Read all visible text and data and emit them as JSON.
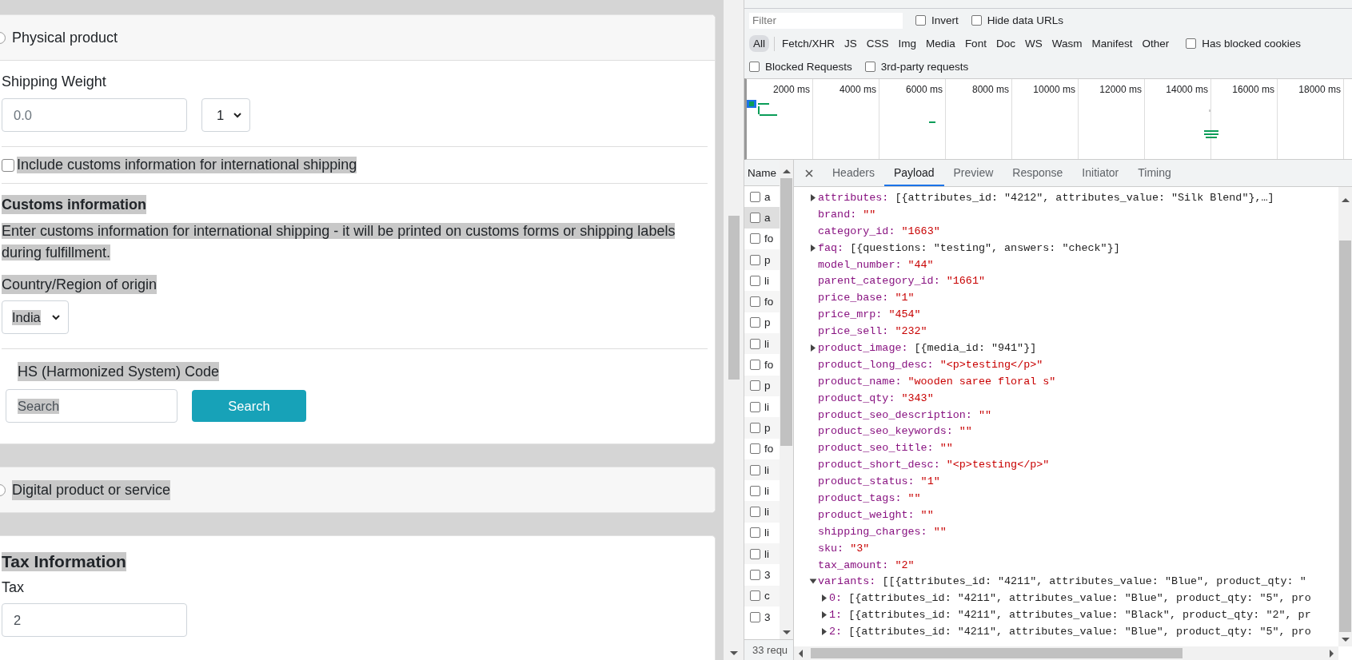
{
  "physical_card": {
    "option": {
      "label": "Physical product",
      "selected": false
    },
    "shipping_weight": {
      "label": "Shipping Weight",
      "placeholder": "0.0",
      "unit": "1"
    },
    "customs_checkbox": {
      "label": "Include customs information for international shipping",
      "checked": false,
      "highlighted": true
    },
    "customs_heading": {
      "text": "Customs information",
      "highlighted": true
    },
    "customs_description": {
      "text": "Enter customs information for international shipping - it will be printed on customs forms or shipping labels during fulfillment.",
      "highlighted": true
    },
    "country_label": {
      "text": "Country/Region of origin",
      "highlighted": true
    },
    "country": {
      "value": "India",
      "highlighted": true
    },
    "hs_label": {
      "text": "HS (Harmonized System) Code",
      "highlighted": true
    },
    "hs_search": {
      "value": "Search",
      "highlighted": true
    },
    "search_button": "Search"
  },
  "digital_card": {
    "option": {
      "label": "Digital product or service",
      "selected": false,
      "highlighted": true
    }
  },
  "tax_card": {
    "heading": {
      "text": "Tax Information",
      "highlighted": true
    },
    "tax_label": "Tax",
    "tax_value": "2"
  },
  "devtools": {
    "filter": {
      "placeholder": "Filter"
    },
    "filter_options": [
      {
        "label": "Invert",
        "checked": false
      },
      {
        "label": "Hide data URLs",
        "checked": false
      }
    ],
    "type_filters": [
      {
        "label": "All",
        "selected": true
      },
      {
        "label": "Fetch/XHR",
        "selected": false
      },
      {
        "label": "JS",
        "selected": false
      },
      {
        "label": "CSS",
        "selected": false
      },
      {
        "label": "Img",
        "selected": false
      },
      {
        "label": "Media",
        "selected": false
      },
      {
        "label": "Font",
        "selected": false
      },
      {
        "label": "Doc",
        "selected": false
      },
      {
        "label": "WS",
        "selected": false
      },
      {
        "label": "Wasm",
        "selected": false
      },
      {
        "label": "Manifest",
        "selected": false
      },
      {
        "label": "Other",
        "selected": false
      }
    ],
    "has_blocked_cookies": {
      "label": "Has blocked cookies",
      "checked": false
    },
    "request_options": [
      {
        "label": "Blocked Requests",
        "checked": false
      },
      {
        "label": "3rd-party requests",
        "checked": false
      }
    ],
    "timeline": {
      "ticks": [
        "2000 ms",
        "4000 ms",
        "6000 ms",
        "8000 ms",
        "10000 ms",
        "12000 ms",
        "14000 ms",
        "16000 ms",
        "18000 ms"
      ]
    },
    "requests": {
      "column": "Name",
      "rows": [
        {
          "name": "a",
          "selected": false
        },
        {
          "name": "a",
          "selected": true
        },
        {
          "name": "fo",
          "selected": false
        },
        {
          "name": "p",
          "selected": false
        },
        {
          "name": "li",
          "selected": false
        },
        {
          "name": "fo",
          "selected": false
        },
        {
          "name": "p",
          "selected": false
        },
        {
          "name": "li",
          "selected": false
        },
        {
          "name": "fo",
          "selected": false
        },
        {
          "name": "p",
          "selected": false
        },
        {
          "name": "li",
          "selected": false
        },
        {
          "name": "p",
          "selected": false
        },
        {
          "name": "fo",
          "selected": false
        },
        {
          "name": "li",
          "selected": false
        },
        {
          "name": "li",
          "selected": false
        },
        {
          "name": "li",
          "selected": false
        },
        {
          "name": "li",
          "selected": false
        },
        {
          "name": "li",
          "selected": false
        },
        {
          "name": "3",
          "selected": false
        },
        {
          "name": "c",
          "selected": false
        },
        {
          "name": "3",
          "selected": false
        }
      ]
    },
    "status": "33 requ",
    "detail_tabs": [
      {
        "label": "Headers",
        "selected": false
      },
      {
        "label": "Payload",
        "selected": true
      },
      {
        "label": "Preview",
        "selected": false
      },
      {
        "label": "Response",
        "selected": false
      },
      {
        "label": "Initiator",
        "selected": false
      },
      {
        "label": "Timing",
        "selected": false
      }
    ],
    "payload": [
      {
        "key": "attributes:",
        "value": "[{attributes_id: \"4212\", attributes_value: \"Silk Blend\"},…]",
        "kind": "object",
        "expanded": false
      },
      {
        "key": "brand:",
        "value": "\"\"",
        "kind": "string"
      },
      {
        "key": "category_id:",
        "value": "\"1663\"",
        "kind": "string"
      },
      {
        "key": "faq:",
        "value": "[{questions: \"testing\", answers: \"check\"}]",
        "kind": "object",
        "expanded": false
      },
      {
        "key": "model_number:",
        "value": "\"44\"",
        "kind": "string"
      },
      {
        "key": "parent_category_id:",
        "value": "\"1661\"",
        "kind": "string"
      },
      {
        "key": "price_base:",
        "value": "\"1\"",
        "kind": "string"
      },
      {
        "key": "price_mrp:",
        "value": "\"454\"",
        "kind": "string"
      },
      {
        "key": "price_sell:",
        "value": "\"232\"",
        "kind": "string"
      },
      {
        "key": "product_image:",
        "value": "[{media_id: \"941\"}]",
        "kind": "object",
        "expanded": false
      },
      {
        "key": "product_long_desc:",
        "value": "\"<p>testing</p>\"",
        "kind": "string"
      },
      {
        "key": "product_name:",
        "value": "\"wooden saree floral s\"",
        "kind": "string"
      },
      {
        "key": "product_qty:",
        "value": "\"343\"",
        "kind": "string"
      },
      {
        "key": "product_seo_description:",
        "value": "\"\"",
        "kind": "string"
      },
      {
        "key": "product_seo_keywords:",
        "value": "\"\"",
        "kind": "string"
      },
      {
        "key": "product_seo_title:",
        "value": "\"\"",
        "kind": "string"
      },
      {
        "key": "product_short_desc:",
        "value": "\"<p>testing</p>\"",
        "kind": "string"
      },
      {
        "key": "product_status:",
        "value": "\"1\"",
        "kind": "string"
      },
      {
        "key": "product_tags:",
        "value": "\"\"",
        "kind": "string"
      },
      {
        "key": "product_weight:",
        "value": "\"\"",
        "kind": "string"
      },
      {
        "key": "shipping_charges:",
        "value": "\"\"",
        "kind": "string"
      },
      {
        "key": "sku:",
        "value": "\"3\"",
        "kind": "string"
      },
      {
        "key": "tax_amount:",
        "value": "\"2\"",
        "kind": "string"
      },
      {
        "key": "variants:",
        "value": "[[{attributes_id: \"4211\", attributes_value: \"Blue\", product_qty: \"",
        "kind": "object",
        "expanded": true,
        "children": [
          {
            "key": "0:",
            "value": "[{attributes_id: \"4211\", attributes_value: \"Blue\", product_qty: \"5\", pro",
            "kind": "object",
            "expanded": false
          },
          {
            "key": "1:",
            "value": "[{attributes_id: \"4211\", attributes_value: \"Black\", product_qty: \"2\", pr",
            "kind": "object",
            "expanded": false
          },
          {
            "key": "2:",
            "value": "[{attributes_id: \"4211\", attributes_value: \"Blue\", product_qty: \"5\", pro",
            "kind": "object",
            "expanded": false
          }
        ]
      }
    ]
  }
}
